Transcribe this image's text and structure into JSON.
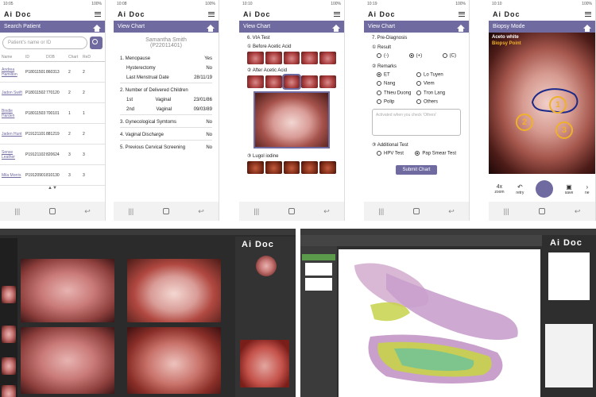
{
  "brand": "Ai Doc",
  "status": {
    "time1": "10:05",
    "time2": "10:08",
    "time3": "10:10",
    "time4": "10:19",
    "time5": "10:10",
    "battery": "100%"
  },
  "screen1": {
    "title": "Search Patient",
    "search_placeholder": "Patient's name or ID",
    "columns": [
      "Name",
      "ID",
      "DOB",
      "Chart",
      "ReD"
    ],
    "rows": [
      {
        "name": "Andrea Hamilton",
        "id": "P18011501",
        "dob": "860313",
        "chart": "2",
        "red": "2"
      },
      {
        "name": "Jadon Swift",
        "id": "P18011502",
        "dob": "770120",
        "chart": "2",
        "red": "2"
      },
      {
        "name": "Bindle Harden",
        "id": "P18011503",
        "dob": "700101",
        "chart": "1",
        "red": "1"
      },
      {
        "name": "Jaden Hunt",
        "id": "P19121101",
        "dob": "881219",
        "chart": "2",
        "red": "2"
      },
      {
        "name": "Sense Leather",
        "id": "P19121102",
        "dob": "820624",
        "chart": "3",
        "red": "3"
      },
      {
        "name": "Mila Morris",
        "id": "P19120901",
        "dob": "810130",
        "chart": "3",
        "red": "3"
      }
    ]
  },
  "screen2": {
    "title": "View Chart",
    "patient": "Samantha Smith",
    "patient_id": "(P22011401)",
    "sections": [
      {
        "label": "1.  Menopause",
        "value": "Yes"
      },
      {
        "label": "Hysterectomy",
        "value": "No"
      },
      {
        "label": "Last Menstrual Date",
        "value": "28/11/19"
      },
      {
        "label": "2.  Number of Delivered Children",
        "value": ""
      },
      {
        "label": "1st",
        "sub": "Vaginal",
        "value": "23/01/86"
      },
      {
        "label": "2nd",
        "sub": "Vaginal",
        "value": "09/03/89"
      },
      {
        "label": "3.  Gynecological Symtoms",
        "value": "No"
      },
      {
        "label": "4.  Vaginal Discharge",
        "value": "No"
      },
      {
        "label": "5.  Previous Cervical Screening",
        "value": "No"
      }
    ]
  },
  "screen3": {
    "title": "View Chart",
    "section": "6. VIA Test",
    "before": "Before Acetic Acid",
    "after": "After Acetic Acid",
    "lugol": "Lugol iodine"
  },
  "screen4": {
    "title": "View Chart",
    "section": "7. Pre-Diagnosis",
    "result_label": "Result",
    "result_options": [
      "(-)",
      "(+)",
      "(C)"
    ],
    "remarks_label": "Remarks",
    "remarks": [
      [
        "ET",
        "Lo Tuyen"
      ],
      [
        "Nang",
        "Viem"
      ],
      [
        "Thieu Duong",
        "Tron Lang"
      ],
      [
        "Polip",
        "Others"
      ]
    ],
    "textarea_placeholder": "Activated when you check 'Others'",
    "additional_label": "Additional Test",
    "tests": [
      "HPV Test",
      "Pap Smear Test"
    ],
    "submit": "Submit Chart"
  },
  "screen5": {
    "title": "Biopsy Mode",
    "aceto": "Aceto white",
    "biopsy_point": "Biopsy Point",
    "points": [
      "1",
      "2",
      "3"
    ],
    "zoom": "4x",
    "zoom_label": "zoom",
    "retry": "retry",
    "save": "save",
    "next": "ne"
  },
  "desktop1": {
    "brand": "Ai Doc"
  },
  "desktop2": {
    "brand": "Ai Doc"
  }
}
